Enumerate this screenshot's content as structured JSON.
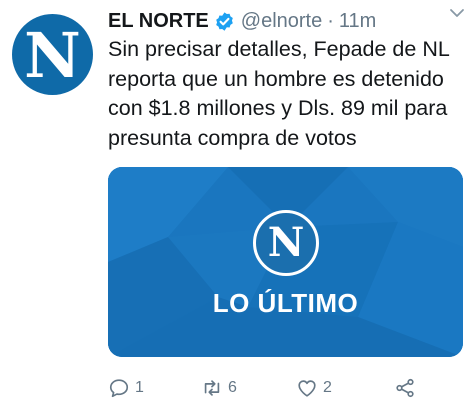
{
  "author": {
    "avatar_letter": "N",
    "name": "EL NORTE",
    "handle": "@elnorte",
    "separator": "·",
    "time": "11m",
    "verified": true
  },
  "tweet": {
    "text": "Sin precisar detalles, Fepade de NL reporta que un hombre es detenido con $1.8 millones y Dls. 89 mil para presunta compra de votos"
  },
  "media": {
    "logo_letter": "N",
    "caption": "LO ÚLTIMO"
  },
  "actions": {
    "reply_count": "1",
    "retweet_count": "6",
    "like_count": "2"
  },
  "colors": {
    "brand_blue": "#0f6aa8",
    "verified_blue": "#1da1f2",
    "muted_gray": "#657786",
    "text": "#14171a"
  },
  "icons": [
    "verified-badge-icon",
    "caret-down-icon",
    "reply-icon",
    "retweet-icon",
    "like-icon",
    "share-icon"
  ]
}
